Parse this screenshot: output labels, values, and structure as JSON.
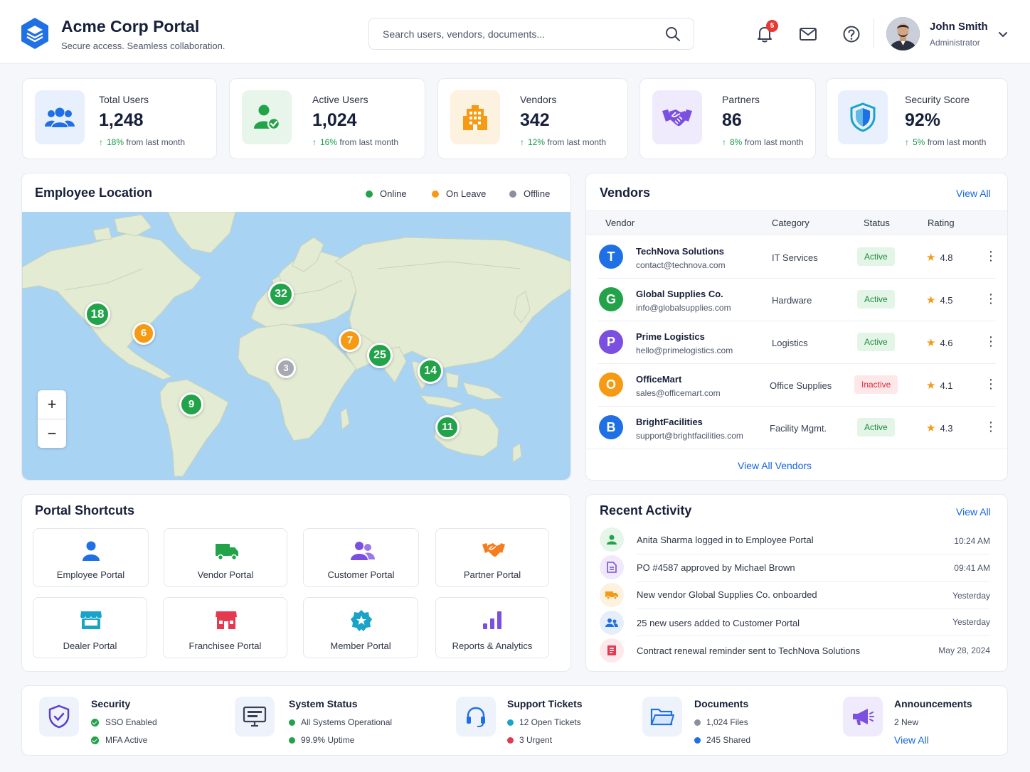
{
  "app": {
    "title": "Acme Corp Portal",
    "subtitle": "Secure access. Seamless collaboration."
  },
  "header": {
    "search_placeholder": "Search users, vendors, documents...",
    "notifications_count": "5",
    "user": {
      "name": "John Smith",
      "role": "Administrator"
    }
  },
  "stats": [
    {
      "label": "Total Users",
      "value": "1,248",
      "delta": "18%",
      "delta_text": "from last month",
      "icon": "users-icon",
      "color": "#1f6fe5"
    },
    {
      "label": "Active Users",
      "value": "1,024",
      "delta": "16%",
      "delta_text": "from last month",
      "icon": "user-check-icon",
      "color": "#22a34a"
    },
    {
      "label": "Vendors",
      "value": "342",
      "delta": "12%",
      "delta_text": "from last month",
      "icon": "building-icon",
      "color": "#f59a12"
    },
    {
      "label": "Partners",
      "value": "86",
      "delta": "8%",
      "delta_text": "from last month",
      "icon": "handshake-icon",
      "color": "#7b4fe0"
    },
    {
      "label": "Security Score",
      "value": "92%",
      "delta": "5%",
      "delta_text": "from last month",
      "icon": "shield-icon",
      "color": "#1f6fe5"
    }
  ],
  "map": {
    "title": "Employee Location",
    "legend": [
      {
        "label": "Online",
        "color": "#22a34a"
      },
      {
        "label": "On Leave",
        "color": "#f59a12"
      },
      {
        "label": "Offline",
        "color": "#8a90a0"
      }
    ],
    "zoom_in": "+",
    "zoom_out": "−",
    "markers": [
      {
        "count": "18",
        "status": "Online"
      },
      {
        "count": "6",
        "status": "On Leave"
      },
      {
        "count": "32",
        "status": "Online"
      },
      {
        "count": "7",
        "status": "On Leave"
      },
      {
        "count": "25",
        "status": "Online"
      },
      {
        "count": "3",
        "status": "Offline"
      },
      {
        "count": "14",
        "status": "Online"
      },
      {
        "count": "9",
        "status": "Online"
      },
      {
        "count": "11",
        "status": "Online"
      }
    ]
  },
  "vendors": {
    "title": "Vendors",
    "view_all": "View All",
    "columns": [
      "Vendor",
      "Category",
      "Status",
      "Rating"
    ],
    "rows": [
      {
        "initial": "T",
        "name": "TechNova Solutions",
        "email": "contact@technova.com",
        "category": "IT Services",
        "status": "Active",
        "rating": "4.8",
        "color": "#1f6fe5"
      },
      {
        "initial": "G",
        "name": "Global Supplies Co.",
        "email": "info@globalsupplies.com",
        "category": "Hardware",
        "status": "Active",
        "rating": "4.5",
        "color": "#22a34a"
      },
      {
        "initial": "P",
        "name": "Prime Logistics",
        "email": "hello@primelogistics.com",
        "category": "Logistics",
        "status": "Active",
        "rating": "4.6",
        "color": "#7b4fe0"
      },
      {
        "initial": "O",
        "name": "OfficeMart",
        "email": "sales@officemart.com",
        "category": "Office Supplies",
        "status": "Inactive",
        "rating": "4.1",
        "color": "#f59a12"
      },
      {
        "initial": "B",
        "name": "BrightFacilities",
        "email": "support@brightfacilities.com",
        "category": "Facility Mgmt.",
        "status": "Active",
        "rating": "4.3",
        "color": "#1f6fe5"
      }
    ],
    "footer_link": "View All Vendors"
  },
  "shortcuts": {
    "title": "Portal Shortcuts",
    "items": [
      {
        "label": "Employee Portal",
        "icon": "person-icon",
        "color": "#1f6fe5"
      },
      {
        "label": "Vendor Portal",
        "icon": "truck-icon",
        "color": "#22a34a"
      },
      {
        "label": "Customer Portal",
        "icon": "group-icon",
        "color": "#7b4fe0"
      },
      {
        "label": "Partner Portal",
        "icon": "handshake-icon",
        "color": "#f57c1f"
      },
      {
        "label": "Dealer Portal",
        "icon": "store-icon",
        "color": "#1aa3c8"
      },
      {
        "label": "Franchisee Portal",
        "icon": "shop-icon",
        "color": "#e53950"
      },
      {
        "label": "Member Portal",
        "icon": "badge-star-icon",
        "color": "#1aa3c8"
      },
      {
        "label": "Reports & Analytics",
        "icon": "bar-chart-icon",
        "color": "#7b4fe0"
      }
    ]
  },
  "activity": {
    "title": "Recent Activity",
    "view_all": "View All",
    "items": [
      {
        "text": "Anita Sharma logged in to Employee Portal",
        "time": "10:24 AM",
        "icon": "user-icon",
        "color": "#22a34a",
        "bg": "#e5f5e8"
      },
      {
        "text": "PO #4587 approved by Michael Brown",
        "time": "09:41 AM",
        "icon": "document-icon",
        "color": "#7b4fe0",
        "bg": "#efe9fb"
      },
      {
        "text": "New vendor Global Supplies Co. onboarded",
        "time": "Yesterday",
        "icon": "truck-icon",
        "color": "#f59a12",
        "bg": "#fdf1e0"
      },
      {
        "text": "25 new users added to Customer Portal",
        "time": "Yesterday",
        "icon": "users-icon",
        "color": "#1f6fe5",
        "bg": "#e6eefc"
      },
      {
        "text": "Contract renewal reminder sent to TechNova Solutions",
        "time": "May 28, 2024",
        "icon": "contract-icon",
        "color": "#e53950",
        "bg": "#fde8eb"
      }
    ]
  },
  "bottom": {
    "security": {
      "title": "Security",
      "lines": [
        "SSO Enabled",
        "MFA Active"
      ]
    },
    "system": {
      "title": "System Status",
      "lines": [
        "All Systems Operational",
        "99.9% Uptime"
      ]
    },
    "support": {
      "title": "Support Tickets",
      "lines": [
        "12 Open Tickets",
        "3 Urgent"
      ]
    },
    "documents": {
      "title": "Documents",
      "lines": [
        "1,024 Files",
        "245 Shared"
      ]
    },
    "announcements": {
      "title": "Announcements",
      "new_count": "2 New",
      "view_all": "View All"
    }
  }
}
